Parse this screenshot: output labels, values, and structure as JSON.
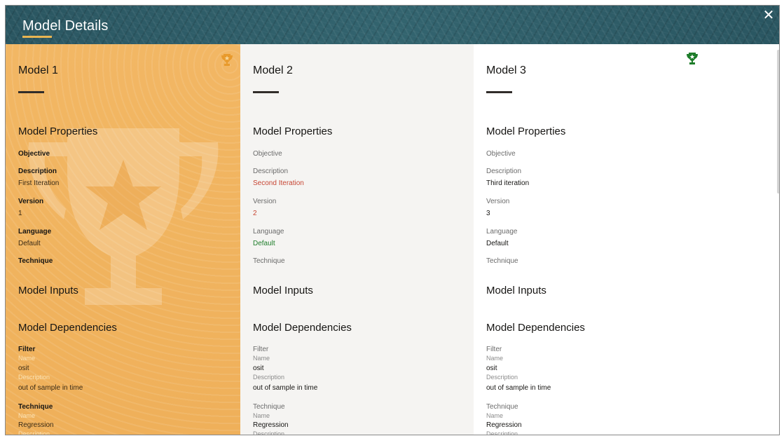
{
  "dialog": {
    "title": "Model Details",
    "close_icon": "close-icon",
    "close_glyph": "✕"
  },
  "colors": {
    "header": "#2c5b66",
    "highlight_column": "#f1b561",
    "title_underline": "#e8b552",
    "red_text": "#c74634",
    "green_text": "#1e7d2a",
    "trophy_gold": "#e89a2c",
    "trophy_green": "#1e7d2a"
  },
  "labels": {
    "model_properties": "Model Properties",
    "objective": "Objective",
    "description": "Description",
    "version": "Version",
    "language": "Language",
    "technique": "Technique",
    "model_inputs": "Model Inputs",
    "model_dependencies": "Model Dependencies",
    "filter": "Filter",
    "name": "Name",
    "dep_technique": "Technique"
  },
  "models": [
    {
      "title": "Model 1",
      "trophy": "trophy-icon",
      "description": "First Iteration",
      "version": "1",
      "language": "Default",
      "filter": {
        "name": "osit",
        "description": "out of sample in time"
      },
      "technique": {
        "name": "Regression"
      }
    },
    {
      "title": "Model 2",
      "description": "Second Iteration",
      "version": "2",
      "language": "Default",
      "filter": {
        "name": "osit",
        "description": "out of sample in time"
      },
      "technique": {
        "name": "Regression"
      }
    },
    {
      "title": "Model 3",
      "trophy": "trophy-icon",
      "description": "Third iteration",
      "version": "3",
      "language": "Default",
      "filter": {
        "name": "osit",
        "description": "out of sample in time"
      },
      "technique": {
        "name": "Regression"
      }
    }
  ]
}
